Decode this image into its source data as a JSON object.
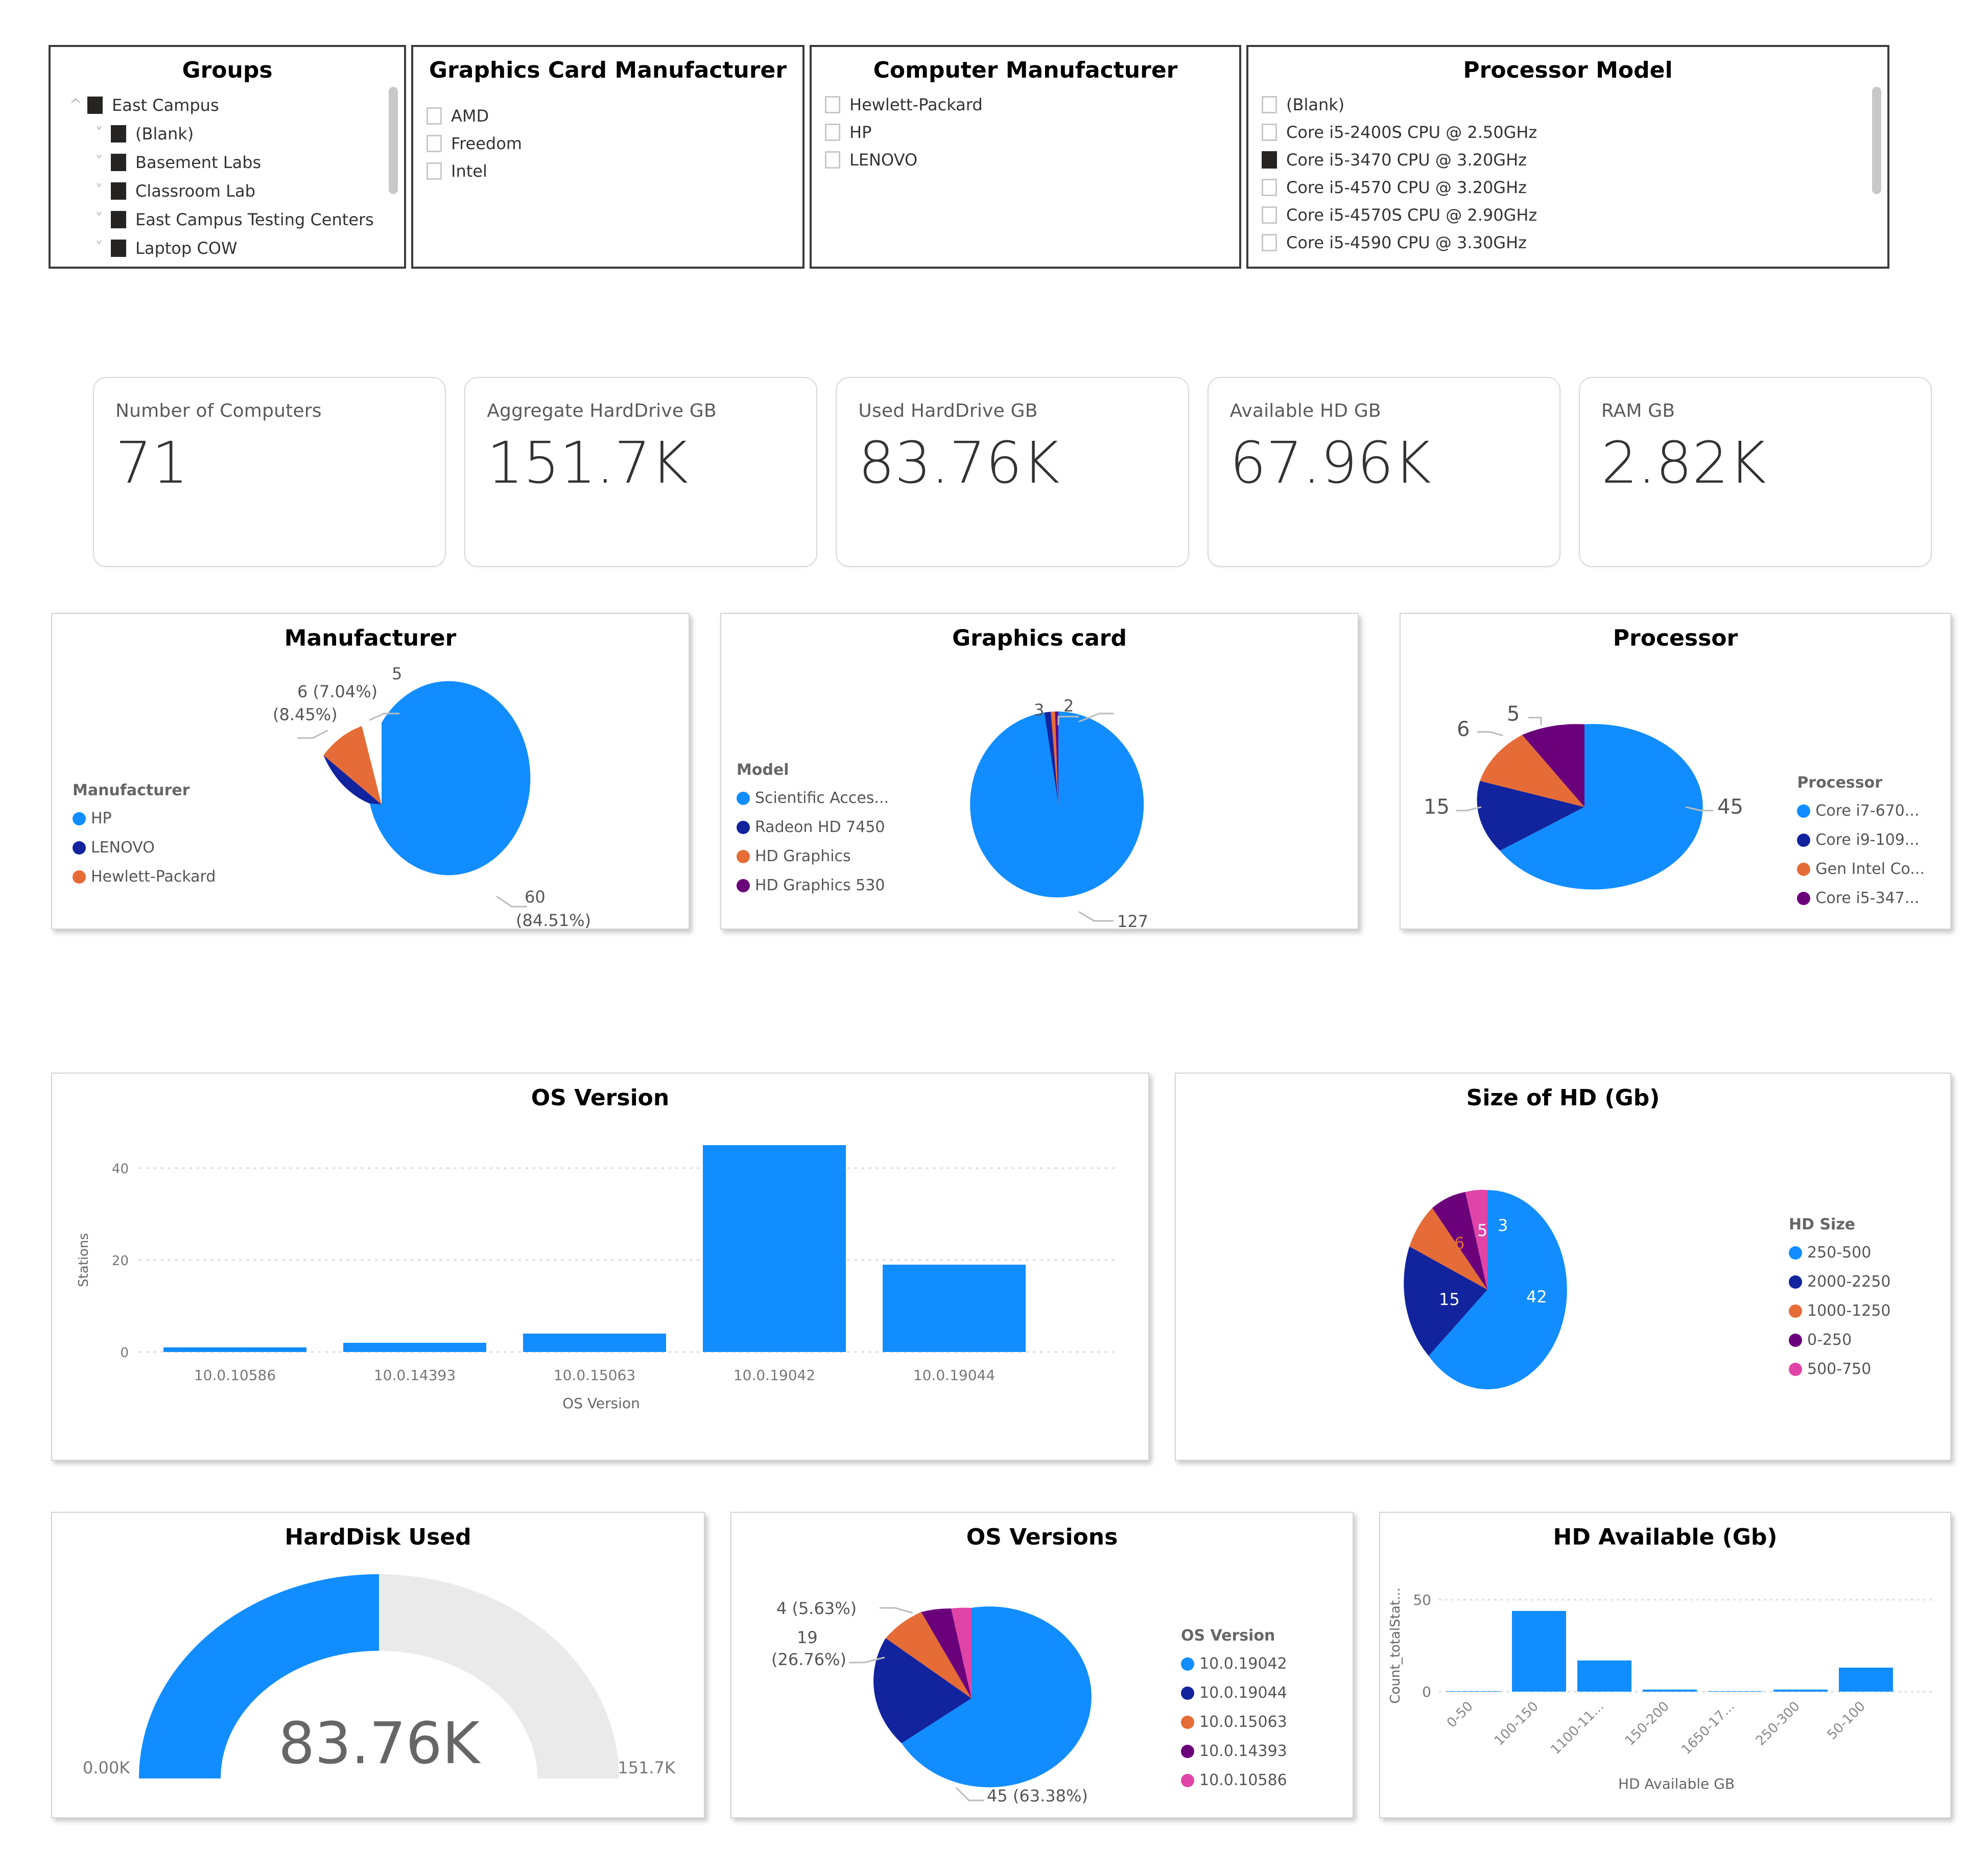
{
  "slicers": {
    "groups": {
      "title": "Groups",
      "items": [
        {
          "label": "East Campus",
          "checked": true,
          "chevron": "^",
          "level": 0
        },
        {
          "label": "(Blank)",
          "checked": true,
          "chevron": "v",
          "level": 1
        },
        {
          "label": "Basement Labs",
          "checked": true,
          "chevron": "v",
          "level": 1
        },
        {
          "label": "Classroom Lab",
          "checked": true,
          "chevron": "v",
          "level": 1
        },
        {
          "label": "East Campus Testing Centers",
          "checked": true,
          "chevron": "v",
          "level": 1
        },
        {
          "label": "Laptop COW",
          "checked": true,
          "chevron": "v",
          "level": 1
        }
      ]
    },
    "graphics_card_manufacturer": {
      "title": "Graphics Card Manufacturer",
      "items": [
        {
          "label": "AMD",
          "checked": false
        },
        {
          "label": "Freedom",
          "checked": false
        },
        {
          "label": "Intel",
          "checked": false
        }
      ]
    },
    "computer_manufacturer": {
      "title": "Computer Manufacturer",
      "items": [
        {
          "label": "Hewlett-Packard",
          "checked": false
        },
        {
          "label": "HP",
          "checked": false
        },
        {
          "label": "LENOVO",
          "checked": false
        }
      ]
    },
    "processor_model": {
      "title": "Processor Model",
      "items": [
        {
          "label": "(Blank)",
          "checked": false
        },
        {
          "label": "Core i5-2400S CPU @ 2.50GHz",
          "checked": false
        },
        {
          "label": "Core i5-3470 CPU @ 3.20GHz",
          "checked": true
        },
        {
          "label": "Core i5-4570 CPU @ 3.20GHz",
          "checked": false
        },
        {
          "label": "Core i5-4570S CPU @ 2.90GHz",
          "checked": false
        },
        {
          "label": "Core i5-4590 CPU @ 3.30GHz",
          "checked": false
        }
      ]
    }
  },
  "kpis": [
    {
      "label": "Number of Computers",
      "value": "71"
    },
    {
      "label": "Aggregate HardDrive GB",
      "value": "151.7K"
    },
    {
      "label": "Used HardDrive GB",
      "value": "83.76K"
    },
    {
      "label": "Available HD GB",
      "value": "67.96K"
    },
    {
      "label": "RAM GB",
      "value": "2.82K"
    }
  ],
  "colors": {
    "blue": "#118DFF",
    "navy": "#12239E",
    "orange": "#E66C37",
    "purple": "#6B007B",
    "magenta": "#E044A7",
    "gauge_track": "#EAEAEA"
  },
  "chart_data": [
    {
      "type": "pie",
      "title": "Manufacturer",
      "legend_title": "Manufacturer",
      "legend_position": "left",
      "categories": [
        "HP",
        "LENOVO",
        "Hewlett-Packard"
      ],
      "values": [
        60,
        6,
        5
      ],
      "colors": [
        "#118DFF",
        "#12239E",
        "#E66C37"
      ],
      "data_labels": [
        "60\n(84.51%)",
        "6 (7.04%)\n(8.45%)",
        "5"
      ],
      "percents": [
        "84.51%",
        "8.45%",
        "7.04%"
      ]
    },
    {
      "type": "pie",
      "title": "Graphics card",
      "legend_title": "Model",
      "legend_position": "left",
      "categories": [
        "Scientific Acces...",
        "Radeon HD 7450",
        "HD Graphics",
        "HD Graphics 530"
      ],
      "values": [
        127,
        3,
        2,
        1
      ],
      "colors": [
        "#118DFF",
        "#12239E",
        "#E66C37",
        "#6B007B"
      ],
      "data_labels": [
        "127",
        "3",
        "2",
        ""
      ]
    },
    {
      "type": "pie",
      "title": "Processor",
      "legend_title": "Processor",
      "legend_position": "right",
      "categories": [
        "Core i7-670...",
        "Core i9-109...",
        "Gen Intel Co...",
        "Core i5-347..."
      ],
      "values": [
        45,
        15,
        6,
        5
      ],
      "colors": [
        "#118DFF",
        "#12239E",
        "#E66C37",
        "#6B007B"
      ],
      "data_labels": [
        "45",
        "15",
        "6",
        "5"
      ]
    },
    {
      "type": "bar",
      "title": "OS Version",
      "xlabel": "OS Version",
      "ylabel": "Stations",
      "categories": [
        "10.0.10586",
        "10.0.14393",
        "10.0.15063",
        "10.0.19042",
        "10.0.19044"
      ],
      "values": [
        1,
        2,
        4,
        45,
        19
      ],
      "ylim": [
        0,
        50
      ],
      "yticks": [
        0,
        20,
        40
      ],
      "grid": true,
      "color": "#118DFF"
    },
    {
      "type": "pie",
      "title": "Size of HD (Gb)",
      "legend_title": "HD Size",
      "legend_position": "right",
      "categories": [
        "250-500",
        "2000-2250",
        "1000-1250",
        "0-250",
        "500-750"
      ],
      "values": [
        42,
        15,
        6,
        5,
        3
      ],
      "colors": [
        "#118DFF",
        "#12239E",
        "#E66C37",
        "#6B007B",
        "#E044A7"
      ],
      "data_labels": [
        "42",
        "15",
        "6",
        "5",
        "3"
      ]
    },
    {
      "type": "gauge",
      "title": "HardDisk Used",
      "value": 83.76,
      "value_label": "83.76K",
      "min": 0,
      "min_label": "0.00K",
      "max": 151.7,
      "max_label": "151.7K",
      "color": "#118DFF",
      "track_color": "#EAEAEA"
    },
    {
      "type": "pie",
      "title": "OS Versions",
      "legend_title": "OS Version",
      "legend_position": "right",
      "categories": [
        "10.0.19042",
        "10.0.19044",
        "10.0.15063",
        "10.0.14393",
        "10.0.10586"
      ],
      "values": [
        45,
        19,
        4,
        2,
        1
      ],
      "colors": [
        "#118DFF",
        "#12239E",
        "#E66C37",
        "#6B007B",
        "#E044A7"
      ],
      "data_labels": [
        "45 (63.38%)",
        "19\n(26.76%)",
        "4 (5.63%)",
        "",
        ""
      ],
      "percents": [
        "63.38%",
        "26.76%",
        "5.63%"
      ]
    },
    {
      "type": "bar",
      "title": "HD Available (Gb)",
      "xlabel": "HD Available GB",
      "ylabel": "Count_totalStat...",
      "categories": [
        "0-50",
        "100-150",
        "1100-11...",
        "150-200",
        "1650-17...",
        "250-300",
        "50-100"
      ],
      "values": [
        0,
        44,
        17,
        1,
        0,
        1,
        13
      ],
      "ylim": [
        0,
        60
      ],
      "yticks": [
        0,
        50
      ],
      "grid": true,
      "color": "#118DFF"
    }
  ]
}
